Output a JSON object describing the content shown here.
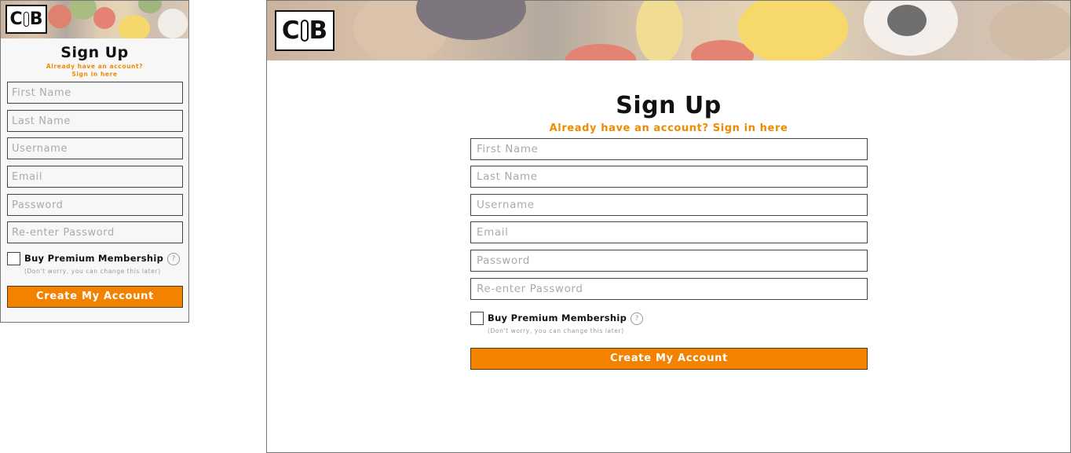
{
  "logo": {
    "text_left": "C",
    "text_right": "B"
  },
  "signup": {
    "title": "Sign Up",
    "signin_prompt_full": "Already have an account? Sign in here",
    "signin_prompt_line1": "Already have an account?",
    "signin_prompt_line2": "Sign in here"
  },
  "fields": {
    "first_name": "First Name",
    "last_name": "Last Name",
    "username": "Username",
    "email": "Email",
    "password": "Password",
    "reenter_password": "Re-enter Password"
  },
  "premium": {
    "label": "Buy Premium Membership",
    "help_icon": "?",
    "hint": "(Don't worry, you can change this later)"
  },
  "cta": {
    "label": "Create My Account"
  },
  "colors": {
    "accent": "#f28200",
    "link": "#f08a00"
  }
}
